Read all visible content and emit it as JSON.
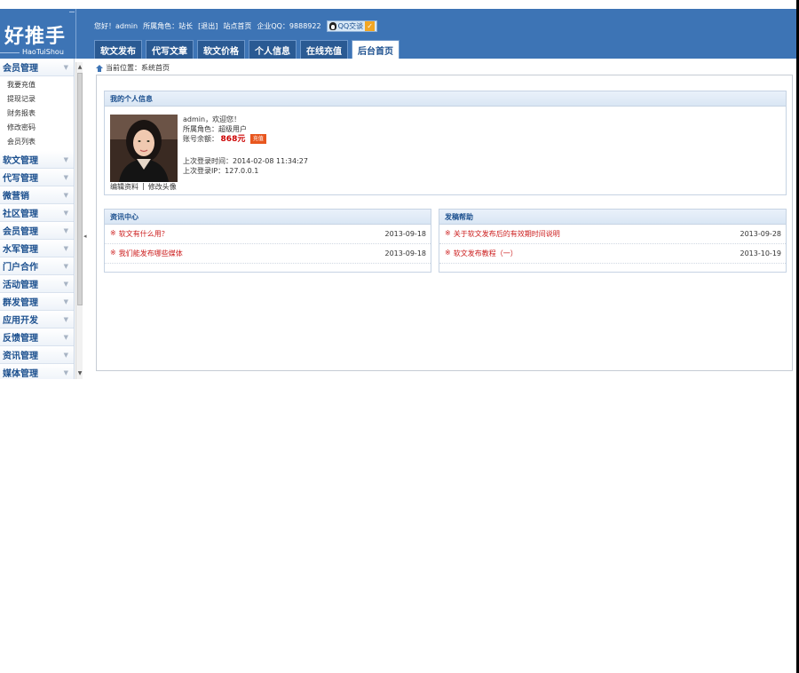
{
  "logo": {
    "cn": "好推手",
    "en": "HaoTuiShou"
  },
  "userbar": {
    "greeting": "您好！admin",
    "role": "所属角色：站长",
    "logout": "[退出]",
    "home": "站点首页",
    "qq": "企业QQ：9888922",
    "qq_chat": "QQ交谈"
  },
  "nav": {
    "tabs": [
      "软文发布",
      "代写文章",
      "软文价格",
      "个人信息",
      "在线充值",
      "后台首页"
    ],
    "active": 5
  },
  "sidebar": {
    "groups": [
      {
        "label": "会员管理",
        "items": [
          "我要充值",
          "提现记录",
          "财务报表",
          "修改密码",
          "会员列表"
        ]
      },
      {
        "label": "软文管理"
      },
      {
        "label": "代写管理"
      },
      {
        "label": "微营销"
      },
      {
        "label": "社区管理"
      },
      {
        "label": "会员管理"
      },
      {
        "label": "水军管理"
      },
      {
        "label": "门户合作"
      },
      {
        "label": "活动管理"
      },
      {
        "label": "群发管理"
      },
      {
        "label": "应用开发"
      },
      {
        "label": "反馈管理"
      },
      {
        "label": "资讯管理"
      },
      {
        "label": "媒体管理"
      }
    ]
  },
  "breadcrumb": "当前位置：系统首页",
  "profile": {
    "title": "我的个人信息",
    "welcome": "admin，欢迎您！",
    "role": "所属角色：超级用户",
    "balance_label": "账号余额：",
    "balance": "868元",
    "vip": "充值",
    "last_login_time": "上次登录时间：2014-02-08 11:34:27",
    "last_login_ip": "上次登录IP：127.0.0.1",
    "edit": "编辑资料",
    "separator": "|",
    "avatar_edit": "修改头像"
  },
  "news": {
    "title": "资讯中心",
    "items": [
      {
        "title": "软文有什么用？",
        "date": "2013-09-18"
      },
      {
        "title": "我们能发布哪些媒体",
        "date": "2013-09-18"
      }
    ]
  },
  "help": {
    "title": "发稿帮助",
    "items": [
      {
        "title": "关于软文发布后的有效期时间说明",
        "date": "2013-09-28"
      },
      {
        "title": "软文发布教程（一）",
        "date": "2013-10-19"
      }
    ]
  },
  "bullet": "※",
  "colors": {
    "header": "#3d74b5",
    "accent": "#1b4f8e",
    "link_red": "#cc1c1c"
  }
}
